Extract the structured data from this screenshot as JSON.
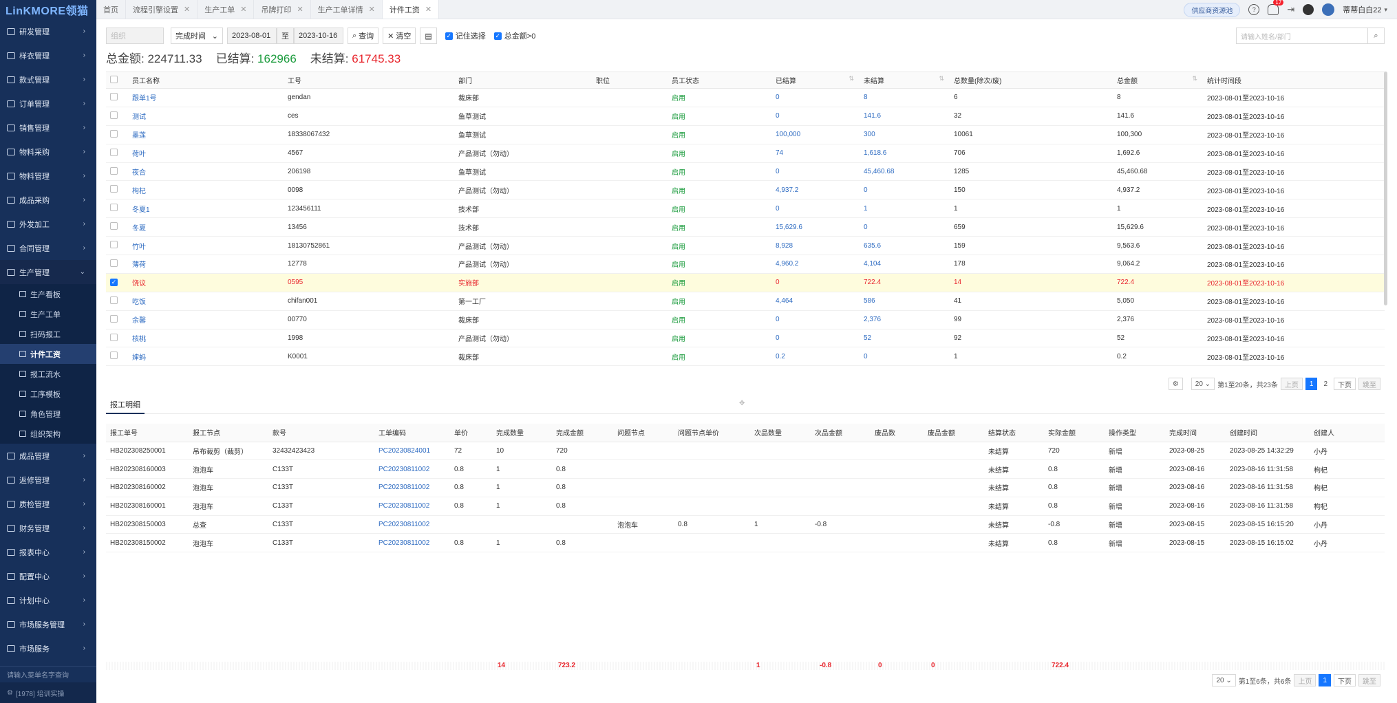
{
  "app": {
    "logo": "LinKMORE领猫",
    "supplier_btn": "供应商资源池",
    "notif_count": "17",
    "username": "蒂蒂白白22"
  },
  "sidebar": {
    "items": [
      {
        "label": "研发管理"
      },
      {
        "label": "样衣管理"
      },
      {
        "label": "款式管理"
      },
      {
        "label": "订单管理"
      },
      {
        "label": "销售管理"
      },
      {
        "label": "物料采购"
      },
      {
        "label": "物料管理"
      },
      {
        "label": "成品采购"
      },
      {
        "label": "外发加工"
      },
      {
        "label": "合同管理"
      },
      {
        "label": "生产管理"
      }
    ],
    "sub_items": [
      {
        "label": "生产看板"
      },
      {
        "label": "生产工单"
      },
      {
        "label": "扫码报工"
      },
      {
        "label": "计件工资"
      },
      {
        "label": "报工流水"
      },
      {
        "label": "工序模板"
      },
      {
        "label": "角色管理"
      },
      {
        "label": "组织架构"
      }
    ],
    "bottom_items": [
      {
        "label": "成品管理"
      },
      {
        "label": "返修管理"
      },
      {
        "label": "质检管理"
      },
      {
        "label": "财务管理"
      },
      {
        "label": "报表中心"
      },
      {
        "label": "配置中心"
      },
      {
        "label": "计划中心"
      },
      {
        "label": "市场服务管理"
      },
      {
        "label": "市场服务"
      }
    ],
    "search_placeholder": "请输入菜单名字查询",
    "footer": "[1978] 培训实操"
  },
  "tabs": [
    {
      "label": "首页"
    },
    {
      "label": "流程引擎设置"
    },
    {
      "label": "生产工单"
    },
    {
      "label": "吊牌打印"
    },
    {
      "label": "生产工单详情"
    },
    {
      "label": "计件工资"
    }
  ],
  "toolbar": {
    "org_placeholder": "组织",
    "date_type": "完成时间",
    "date_from": "2023-08-01",
    "date_to_label": "至",
    "date_to": "2023-10-16",
    "query": "查询",
    "clear": "清空",
    "remember": "记住选择",
    "total_gt0": "总金额>0",
    "search_placeholder": "请输入姓名/部门"
  },
  "totals": {
    "total_label": "总金额:",
    "total_value": "224711.33",
    "settled_label": "已结算:",
    "settled_value": "162966",
    "unsettled_label": "未结算:",
    "unsettled_value": "61745.33"
  },
  "main_table": {
    "headers": [
      "员工名称",
      "工号",
      "部门",
      "职位",
      "员工状态",
      "已结算",
      "未结算",
      "总数量(除次/废)",
      "总金额",
      "统计时间段"
    ],
    "rows": [
      {
        "name": "跟单1号",
        "id": "gendan",
        "dept": "裁床部",
        "pos": "",
        "status": "启用",
        "settled": "0",
        "unsettled": "8",
        "qty": "6",
        "total": "8",
        "period": "2023-08-01至2023-10-16"
      },
      {
        "name": "测试",
        "id": "ces",
        "dept": "鱼草测试",
        "pos": "",
        "status": "启用",
        "settled": "0",
        "unsettled": "141.6",
        "qty": "32",
        "total": "141.6",
        "period": "2023-08-01至2023-10-16"
      },
      {
        "name": "墨莲",
        "id": "18338067432",
        "dept": "鱼草测试",
        "pos": "",
        "status": "启用",
        "settled": "100,000",
        "unsettled": "300",
        "qty": "10061",
        "total": "100,300",
        "period": "2023-08-01至2023-10-16"
      },
      {
        "name": "荷叶",
        "id": "4567",
        "dept": "产品测试（勿动）",
        "pos": "",
        "status": "启用",
        "settled": "74",
        "unsettled": "1,618.6",
        "qty": "706",
        "total": "1,692.6",
        "period": "2023-08-01至2023-10-16"
      },
      {
        "name": "夜合",
        "id": "206198",
        "dept": "鱼草测试",
        "pos": "",
        "status": "启用",
        "settled": "0",
        "unsettled": "45,460.68",
        "qty": "1285",
        "total": "45,460.68",
        "period": "2023-08-01至2023-10-16"
      },
      {
        "name": "枸杞",
        "id": "0098",
        "dept": "产品测试（勿动）",
        "pos": "",
        "status": "启用",
        "settled": "4,937.2",
        "unsettled": "0",
        "qty": "150",
        "total": "4,937.2",
        "period": "2023-08-01至2023-10-16"
      },
      {
        "name": "冬夏1",
        "id": "123456111",
        "dept": "技术部",
        "pos": "",
        "status": "启用",
        "settled": "0",
        "unsettled": "1",
        "qty": "1",
        "total": "1",
        "period": "2023-08-01至2023-10-16"
      },
      {
        "name": "冬夏",
        "id": "13456",
        "dept": "技术部",
        "pos": "",
        "status": "启用",
        "settled": "15,629.6",
        "unsettled": "0",
        "qty": "659",
        "total": "15,629.6",
        "period": "2023-08-01至2023-10-16"
      },
      {
        "name": "竹叶",
        "id": "18130752861",
        "dept": "产品测试（勿动）",
        "pos": "",
        "status": "启用",
        "settled": "8,928",
        "unsettled": "635.6",
        "qty": "159",
        "total": "9,563.6",
        "period": "2023-08-01至2023-10-16"
      },
      {
        "name": "薄荷",
        "id": "12778",
        "dept": "产品测试（勿动）",
        "pos": "",
        "status": "启用",
        "settled": "4,960.2",
        "unsettled": "4,104",
        "qty": "178",
        "total": "9,064.2",
        "period": "2023-08-01至2023-10-16"
      },
      {
        "name": "饶议",
        "id": "0595",
        "dept": "实施部",
        "pos": "",
        "status": "启用",
        "settled": "0",
        "unsettled": "722.4",
        "qty": "14",
        "total": "722.4",
        "period": "2023-08-01至2023-10-16",
        "selected": true
      },
      {
        "name": "吃饭",
        "id": "chifan001",
        "dept": "第一工厂",
        "pos": "",
        "status": "启用",
        "settled": "4,464",
        "unsettled": "586",
        "qty": "41",
        "total": "5,050",
        "period": "2023-08-01至2023-10-16"
      },
      {
        "name": "余馨",
        "id": "00770",
        "dept": "裁床部",
        "pos": "",
        "status": "启用",
        "settled": "0",
        "unsettled": "2,376",
        "qty": "99",
        "total": "2,376",
        "period": "2023-08-01至2023-10-16"
      },
      {
        "name": "核桃",
        "id": "1998",
        "dept": "产品测试（勿动）",
        "pos": "",
        "status": "启用",
        "settled": "0",
        "unsettled": "52",
        "qty": "92",
        "total": "52",
        "period": "2023-08-01至2023-10-16"
      },
      {
        "name": "婶蚂",
        "id": "K0001",
        "dept": "裁床部",
        "pos": "",
        "status": "启用",
        "settled": "0.2",
        "unsettled": "0",
        "qty": "1",
        "total": "0.2",
        "period": "2023-08-01至2023-10-16"
      }
    ]
  },
  "pager1": {
    "page_size": "20",
    "info": "第1至20条，共23条",
    "prev": "上页",
    "p1": "1",
    "p2": "2",
    "next": "下页",
    "jump": "跳至"
  },
  "detail": {
    "tab_label": "报工明细",
    "headers": [
      "报工单号",
      "报工节点",
      "款号",
      "工单编码",
      "单价",
      "完成数量",
      "完成金额",
      "问题节点",
      "问题节点单价",
      "次品数量",
      "次品金额",
      "废品数",
      "废品金额",
      "结算状态",
      "实际金额",
      "操作类型",
      "完成时间",
      "创建时间",
      "创建人"
    ],
    "rows": [
      {
        "no": "HB202308250001",
        "node": "吊布裁剪（裁剪）",
        "style": "32432423423",
        "wo": "PC20230824001",
        "price": "72",
        "qty": "10",
        "amt": "720",
        "pnode": "",
        "pprice": "",
        "dqty": "",
        "damt": "",
        "wqty": "",
        "wamt": "",
        "state": "未结算",
        "actual": "720",
        "op": "新增",
        "done": "2023-08-25",
        "created": "2023-08-25 14:32:29",
        "creator": "小丹"
      },
      {
        "no": "HB202308160003",
        "node": "泡泡车",
        "style": "C133T",
        "wo": "PC20230811002",
        "price": "0.8",
        "qty": "1",
        "amt": "0.8",
        "pnode": "",
        "pprice": "",
        "dqty": "",
        "damt": "",
        "wqty": "",
        "wamt": "",
        "state": "未结算",
        "actual": "0.8",
        "op": "新增",
        "done": "2023-08-16",
        "created": "2023-08-16 11:31:58",
        "creator": "枸杞"
      },
      {
        "no": "HB202308160002",
        "node": "泡泡车",
        "style": "C133T",
        "wo": "PC20230811002",
        "price": "0.8",
        "qty": "1",
        "amt": "0.8",
        "pnode": "",
        "pprice": "",
        "dqty": "",
        "damt": "",
        "wqty": "",
        "wamt": "",
        "state": "未结算",
        "actual": "0.8",
        "op": "新增",
        "done": "2023-08-16",
        "created": "2023-08-16 11:31:58",
        "creator": "枸杞"
      },
      {
        "no": "HB202308160001",
        "node": "泡泡车",
        "style": "C133T",
        "wo": "PC20230811002",
        "price": "0.8",
        "qty": "1",
        "amt": "0.8",
        "pnode": "",
        "pprice": "",
        "dqty": "",
        "damt": "",
        "wqty": "",
        "wamt": "",
        "state": "未结算",
        "actual": "0.8",
        "op": "新增",
        "done": "2023-08-16",
        "created": "2023-08-16 11:31:58",
        "creator": "枸杞"
      },
      {
        "no": "HB202308150003",
        "node": "总查",
        "style": "C133T",
        "wo": "PC20230811002",
        "price": "",
        "qty": "",
        "amt": "",
        "pnode": "泡泡车",
        "pprice": "0.8",
        "dqty": "1",
        "damt": "-0.8",
        "wqty": "",
        "wamt": "",
        "state": "未结算",
        "actual": "-0.8",
        "op": "新增",
        "done": "2023-08-15",
        "created": "2023-08-15 16:15:20",
        "creator": "小丹"
      },
      {
        "no": "HB202308150002",
        "node": "泡泡车",
        "style": "C133T",
        "wo": "PC20230811002",
        "price": "0.8",
        "qty": "1",
        "amt": "0.8",
        "pnode": "",
        "pprice": "",
        "dqty": "",
        "damt": "",
        "wqty": "",
        "wamt": "",
        "state": "未结算",
        "actual": "0.8",
        "op": "新增",
        "done": "2023-08-15",
        "created": "2023-08-15 16:15:02",
        "creator": "小丹"
      }
    ],
    "sums": {
      "qty": "14",
      "amt": "723.2",
      "dqty": "1",
      "damt": "-0.8",
      "wqty": "0",
      "wamt": "0",
      "actual": "722.4"
    }
  },
  "pager2": {
    "page_size": "20",
    "info": "第1至6条，共6条",
    "prev": "上页",
    "p1": "1",
    "next": "下页",
    "jump": "跳至"
  },
  "colors": {
    "sidebar_bg": "#17305a",
    "primary": "#1677ff",
    "settled_green": "#1a9b3c",
    "unsettled_red": "#e8262d",
    "link_blue": "#2f6cc2"
  }
}
